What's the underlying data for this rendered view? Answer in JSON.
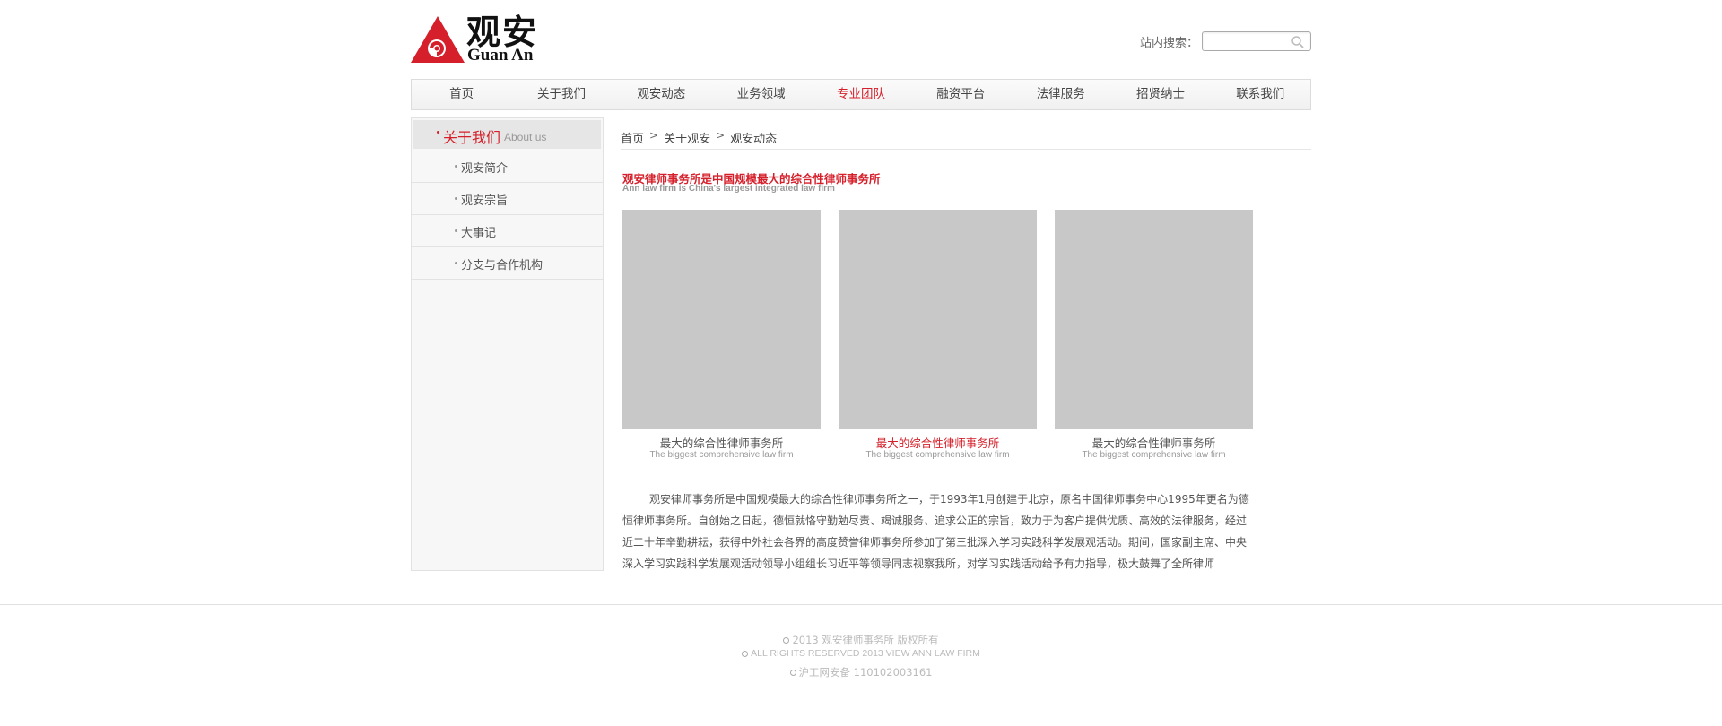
{
  "header": {
    "logo_cn": "观安",
    "logo_en": "Guan An",
    "search_label": "站内搜索：",
    "search_value": ""
  },
  "nav": [
    {
      "label": "首页",
      "active": false
    },
    {
      "label": "关于我们",
      "active": false
    },
    {
      "label": "观安动态",
      "active": false
    },
    {
      "label": "业务领域",
      "active": false
    },
    {
      "label": "专业团队",
      "active": true
    },
    {
      "label": "融资平台",
      "active": false
    },
    {
      "label": "法律服务",
      "active": false
    },
    {
      "label": "招贤纳士",
      "active": false
    },
    {
      "label": "联系我们",
      "active": false
    }
  ],
  "sidebar": {
    "title_cn": "关于我们",
    "title_en": "About us",
    "items": [
      {
        "label": "观安简介"
      },
      {
        "label": "观安宗旨"
      },
      {
        "label": "大事记"
      },
      {
        "label": "分支与合作机构"
      }
    ]
  },
  "breadcrumb": {
    "home": "首页",
    "level1": "关于观安",
    "level2": "观安动态"
  },
  "main": {
    "headline_cn": "观安律师事务所是中国规模最大的综合性律师事务所",
    "headline_en": "Ann law firm is China's largest integrated law firm",
    "cards": [
      {
        "title_cn": "最大的综合性律师事务所",
        "title_en": "The biggest comprehensive law firm",
        "highlight": false
      },
      {
        "title_cn": "最大的综合性律师事务所",
        "title_en": "The biggest comprehensive law firm",
        "highlight": true
      },
      {
        "title_cn": "最大的综合性律师事务所",
        "title_en": "The biggest comprehensive law firm",
        "highlight": false
      }
    ],
    "paragraph": "观安律师事务所是中国规模最大的综合性律师事务所之一，于1993年1月创建于北京，原名中国律师事务中心1995年更名为德恒律师事务所。自创始之日起，德恒就恪守勤勉尽责、竭诚服务、追求公正的宗旨，致力于为客户提供优质、高效的法律服务，经过近二十年辛勤耕耘，获得中外社会各界的高度赞誉律师事务所参加了第三批深入学习实践科学发展观活动。期间，国家副主席、中央深入学习实践科学发展观活动领导小组组长习近平等领导同志视察我所，对学习实践活动给予有力指导，极大鼓舞了全所律师"
  },
  "footer": {
    "line1": "2013  观安律师事务所  版权所有",
    "line2": "ALL RIGHTS RESERVED 2013 VIEW ANN LAW FIRM",
    "line3": "沪工网安备  110102003161"
  },
  "colors": {
    "accent": "#d51f2a",
    "placeholder_image": "#c8c8c8",
    "sidebar_bg": "#f7f7f7"
  }
}
